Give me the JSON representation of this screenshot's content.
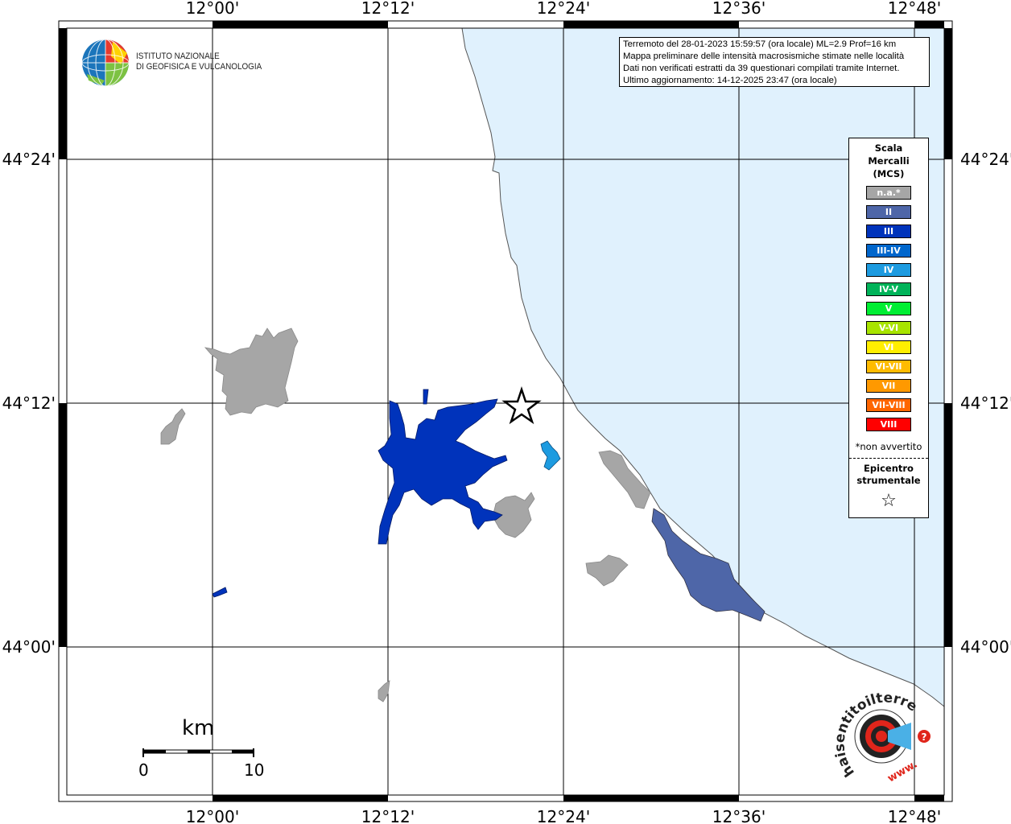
{
  "map": {
    "top_labels": [
      "12°00'",
      "12°12'",
      "12°24'",
      "12°36'",
      "12°48'"
    ],
    "bottom_labels": [
      "12°00'",
      "12°12'",
      "12°24'",
      "12°36'",
      "12°48'"
    ],
    "left_labels": [
      "44°24'",
      "44°12'",
      "44°00'"
    ],
    "right_labels": [
      "44°24'",
      "44°12'",
      "44°00'"
    ],
    "sea_color": "#e0f1fd",
    "land_color": "#ffffff"
  },
  "logo": {
    "line1": "ISTITUTO NAZIONALE",
    "line2": "DI GEOFISICA E VULCANOLOGIA"
  },
  "info": {
    "line1": "Terremoto del 28-01-2023 15:59:57 (ora locale) ML=2.9 Prof=16 km",
    "line2": "Mappa preliminare delle intensità macrosismiche stimate nelle località",
    "line3": "Dati non verificati estratti da 39 questionari compilati tramite Internet.",
    "line4": "Ultimo aggiornamento: 14-12-2025 23:47 (ora locale)"
  },
  "legend": {
    "title1": "Scala",
    "title2": "Mercalli",
    "title3": "(MCS)",
    "items": [
      {
        "label": "n.a.*",
        "color": "#a6a6a6"
      },
      {
        "label": "II",
        "color": "#4e66a8"
      },
      {
        "label": "III",
        "color": "#0033bb"
      },
      {
        "label": "III-IV",
        "color": "#0066cc"
      },
      {
        "label": "IV",
        "color": "#1d9be0"
      },
      {
        "label": "IV-V",
        "color": "#00b359"
      },
      {
        "label": "V",
        "color": "#00ee33"
      },
      {
        "label": "V-VI",
        "color": "#a8e400"
      },
      {
        "label": "VI",
        "color": "#ffee00"
      },
      {
        "label": "VI-VII",
        "color": "#ffbb00"
      },
      {
        "label": "VII",
        "color": "#ff9900"
      },
      {
        "label": "VII-VIII",
        "color": "#ff6600"
      },
      {
        "label": "VIII",
        "color": "#ff0000"
      }
    ],
    "note": "*non avvertito",
    "epi1": "Epicentro",
    "epi2": "strumentale",
    "star": "☆"
  },
  "scale_bar": {
    "unit": "km",
    "start": "0",
    "end": "10"
  },
  "hsit": {
    "text": "haisentitoilterremoto.it",
    "www": "www."
  }
}
